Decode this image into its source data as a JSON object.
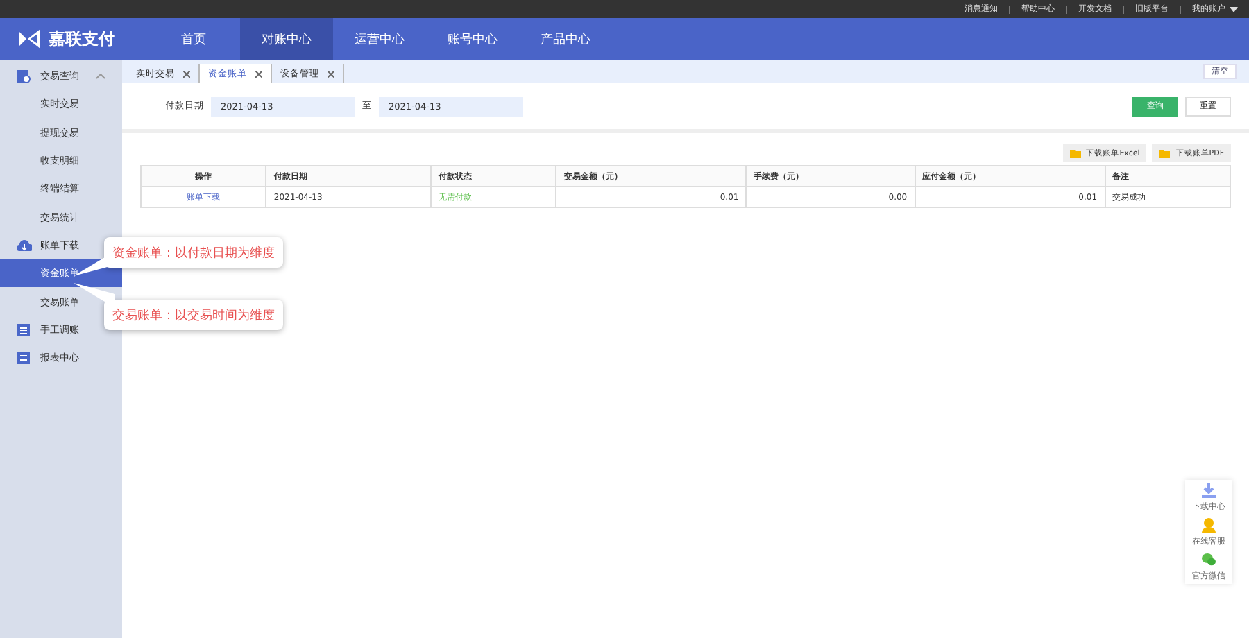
{
  "top_links": [
    {
      "label": "消息通知"
    },
    {
      "label": "帮助中心"
    },
    {
      "label": "开发文档"
    },
    {
      "label": "旧版平台"
    },
    {
      "label": "我的账户",
      "dropdown": true
    }
  ],
  "header": {
    "logo": "嘉联支付",
    "nav": [
      {
        "label": "首页",
        "selected": false
      },
      {
        "label": "对账中心",
        "selected": true
      },
      {
        "label": "运营中心",
        "selected": false
      },
      {
        "label": "账号中心",
        "selected": false
      },
      {
        "label": "产品中心",
        "selected": false
      }
    ]
  },
  "sidebar": {
    "items": [
      {
        "label": "交易查询",
        "kind": "search",
        "expanded": true,
        "children": [
          {
            "label": "实时交易",
            "selected": false
          },
          {
            "label": "提现交易",
            "selected": false
          },
          {
            "label": "收支明细",
            "selected": false
          },
          {
            "label": "终端结算",
            "selected": false
          },
          {
            "label": "交易统计",
            "selected": false
          }
        ]
      },
      {
        "label": "账单下载",
        "kind": "cloud",
        "children": [
          {
            "label": "资金账单",
            "selected": true
          },
          {
            "label": "交易账单",
            "selected": false
          }
        ]
      },
      {
        "label": "手工调账",
        "kind": "list"
      },
      {
        "label": "报表中心",
        "kind": "chart"
      }
    ]
  },
  "tabs": [
    {
      "label": "实时交易",
      "selected": false
    },
    {
      "label": "资金账单",
      "selected": true
    },
    {
      "label": "设备管理",
      "selected": false
    }
  ],
  "clear_button": "清空",
  "filter": {
    "label": "付款日期",
    "from": "2021-04-13",
    "separator": "至",
    "to": "2021-04-13",
    "query_button": "查询",
    "reset_button": "重置"
  },
  "download_buttons": [
    "下载账单Excel",
    "下载账单PDF"
  ],
  "table": {
    "columns": [
      "操作",
      "付款日期",
      "付款状态",
      "交易金额（元）",
      "手续费（元）",
      "应付金额（元）",
      "备注"
    ],
    "rows": [
      [
        {
          "text": "账单下载",
          "kind": "link"
        },
        {
          "text": "2021-04-13",
          "kind": "text"
        },
        {
          "text": "无需付款",
          "kind": "status"
        },
        {
          "text": "0.01",
          "kind": "number"
        },
        {
          "text": "0.00",
          "kind": "number"
        },
        {
          "text": "0.01",
          "kind": "number"
        },
        {
          "text": "交易成功",
          "kind": "text"
        }
      ]
    ]
  },
  "callouts": [
    {
      "text": "资金账单：以付款日期为维度"
    },
    {
      "text": "交易账单：以交易时间为维度"
    }
  ],
  "float_panel": [
    {
      "label": "下载中心",
      "kind": "download"
    },
    {
      "label": "在线客服",
      "kind": "agent"
    },
    {
      "label": "官方微信",
      "kind": "wechat"
    }
  ]
}
